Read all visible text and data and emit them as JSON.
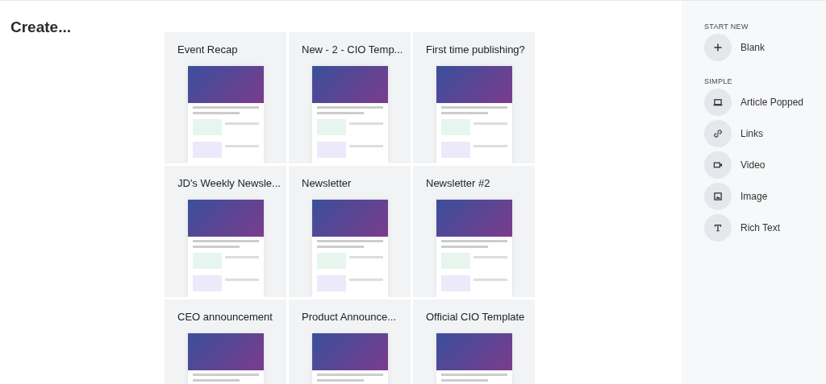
{
  "page_title": "Create...",
  "templates": [
    {
      "title": "Event Recap"
    },
    {
      "title": "New - 2 - CIO Temp..."
    },
    {
      "title": "First time publishing?"
    },
    {
      "title": "JD's Weekly Newsle..."
    },
    {
      "title": "Newsletter"
    },
    {
      "title": "Newsletter #2"
    },
    {
      "title": "CEO announcement"
    },
    {
      "title": "Product Announce..."
    },
    {
      "title": "Official CIO Template"
    }
  ],
  "sidebar": {
    "sections": [
      {
        "heading": "START NEW",
        "items": [
          {
            "label": "Blank",
            "kind": "plus"
          }
        ]
      },
      {
        "heading": "SIMPLE",
        "items": [
          {
            "label": "Article Popped",
            "kind": "article"
          },
          {
            "label": "Links",
            "kind": "link"
          },
          {
            "label": "Video",
            "kind": "video"
          },
          {
            "label": "Image",
            "kind": "image"
          },
          {
            "label": "Rich Text",
            "kind": "text"
          }
        ]
      }
    ]
  }
}
